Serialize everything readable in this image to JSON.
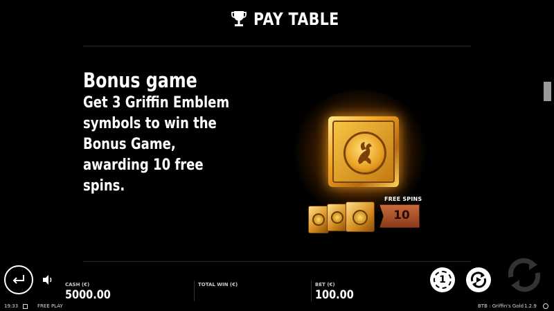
{
  "header": {
    "title": "PAY TABLE",
    "icon": "trophy-icon"
  },
  "content": {
    "heading": "Bonus game",
    "description": "Get 3 Griffin Emblem symbols to win the Bonus Game, awarding 10 free spins.",
    "free_spins_label": "FREE SPINS",
    "free_spins_value": "10",
    "symbol_name": "griffin-emblem-symbol"
  },
  "bottom_bar": {
    "cash_label": "CASH (€)",
    "cash_value": "5000.00",
    "total_win_label": "TOTAL WIN (€)",
    "total_win_value": "",
    "bet_label": "BET (€)",
    "bet_value": "100.00",
    "coin_value": "1"
  },
  "status_bar": {
    "time": "19:33",
    "mode": "FREE PLAY",
    "game_name": "BTB : Griffin's Gold",
    "version": "1.2.9"
  },
  "colors": {
    "background": "#000000",
    "gold": "#f0a826",
    "badge": "#b0522a"
  }
}
